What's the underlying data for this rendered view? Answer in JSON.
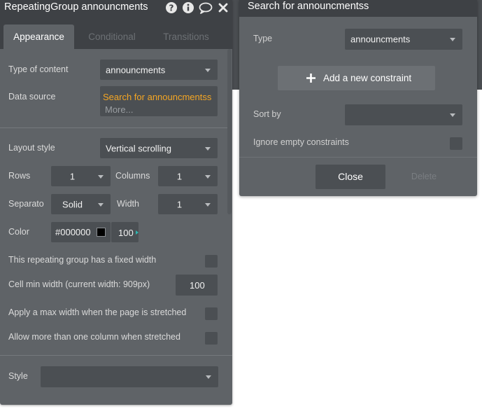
{
  "editor": {
    "title": "RepeatingGroup announcments",
    "icons": [
      "help-icon",
      "info-icon",
      "comment-icon",
      "close-icon"
    ],
    "tabs": [
      {
        "label": "Appearance",
        "active": true
      },
      {
        "label": "Conditional",
        "active": false
      },
      {
        "label": "Transitions",
        "active": false
      }
    ],
    "type_of_content": {
      "label": "Type of content",
      "value": "announcments"
    },
    "data_source": {
      "label": "Data source",
      "value": "Search for announcmentss",
      "more": "More..."
    },
    "layout_style": {
      "label": "Layout style",
      "value": "Vertical scrolling"
    },
    "rows": {
      "label": "Rows",
      "value": "1"
    },
    "columns": {
      "label": "Columns",
      "value": "1"
    },
    "separator": {
      "label": "Separato",
      "value": "Solid"
    },
    "width": {
      "label": "Width",
      "value": "1"
    },
    "color": {
      "label": "Color",
      "hex": "#000000",
      "swatch": "#000000",
      "opacity": "100"
    },
    "fixed_width": {
      "label": "This repeating group has a fixed width",
      "checked": false
    },
    "cell_min_width": {
      "label": "Cell min width (current width: 909px)",
      "value": "100"
    },
    "max_width": {
      "label": "Apply a max width when the page is stretched",
      "checked": false
    },
    "multi_column": {
      "label": "Allow more than one column when stretched",
      "checked": false
    },
    "style": {
      "label": "Style",
      "value": ""
    }
  },
  "search_dialog": {
    "title": "Search for announcmentss",
    "type": {
      "label": "Type",
      "value": "announcments"
    },
    "add_constraint_label": "Add a new constraint",
    "sort_by": {
      "label": "Sort by",
      "value": ""
    },
    "ignore_empty": {
      "label": "Ignore empty constraints",
      "checked": false
    },
    "close_label": "Close",
    "delete_label": "Delete"
  },
  "colors": {
    "panel_bg": "#5f6367",
    "title_bar": "#3e4145",
    "field_bg": "#4b4f53",
    "link_orange": "#f5a623",
    "teal_accent": "#2fb5b0"
  }
}
